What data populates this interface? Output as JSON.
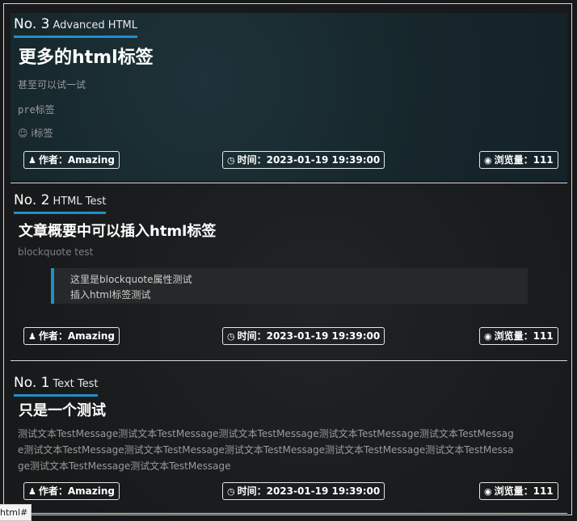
{
  "posts": [
    {
      "no": "No. 3",
      "category": "Advanced HTML",
      "title": "更多的html标签",
      "lines": [
        "甚至可以试一试",
        "pre标签",
        "☺ i标签"
      ],
      "author": "作者：Amazing",
      "time": "时间：2023-01-19 19:39:00",
      "views": "浏览量：111"
    },
    {
      "no": "No. 2",
      "category": "HTML Test",
      "title": "文章概要中可以插入html标签",
      "summary": "blockquote test",
      "quote": [
        "这里是blockquote属性测试",
        "插入html标签测试"
      ],
      "author": "作者：Amazing",
      "time": "时间：2023-01-19 19:39:00",
      "views": "浏览量：111"
    },
    {
      "no": "No. 1",
      "category": "Text Test",
      "title": "只是一个测试",
      "body": "测试文本TestMessage测试文本TestMessage测试文本TestMessage测试文本TestMessage测试文本TestMessage测试文本TestMessage测试文本TestMessage测试文本TestMessage测试文本TestMessage测试文本TestMessage测试文本TestMessage测试文本TestMessage",
      "author": "作者：Amazing",
      "time": "时间：2023-01-19 19:39:00",
      "views": "浏览量：111"
    }
  ],
  "status_url": "html#",
  "colors": {
    "accent": "#1e90c9",
    "background": "#17191a",
    "border": "#d9d9d9"
  },
  "icons": {
    "author": "user-icon",
    "time": "clock-icon",
    "views": "eye-icon"
  }
}
